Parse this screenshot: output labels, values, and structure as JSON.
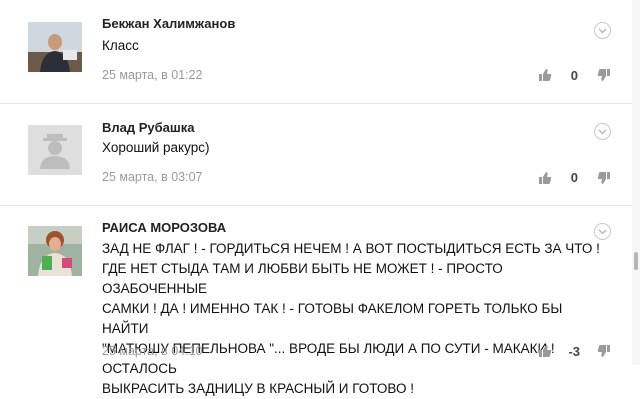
{
  "comments": [
    {
      "author": "Бекжан Халимжанов",
      "text": "Класс",
      "date": "25 марта, в 01:22",
      "score": "0",
      "avatar_icon": "user-photo"
    },
    {
      "author": "Влад Рубашка",
      "text": "Хороший ракурс)",
      "date": "25 марта, в 03:07",
      "score": "0",
      "avatar_icon": "default-avatar-icon"
    },
    {
      "author": "РАИСА МОРОЗОВА",
      "text": "ЗАД НЕ ФЛАГ ! - ГОРДИТЬСЯ НЕЧЕМ ! А ВОТ ПОСТЫДИТЬСЯ ЕСТЬ ЗА ЧТО !\nГДЕ НЕТ СТЫДА ТАМ И ЛЮБВИ БЫТЬ НЕ МОЖЕТ ! - ПРОСТО ОЗАБОЧЕННЫЕ\nСАМКИ ! ДА ! ИМЕННО ТАК ! - ГОТОВЫ ФАКЕЛОМ ГОРЕТЬ ТОЛЬКО БЫ НАЙТИ\n\"МАТЮШУ ПЕПЕЛЬНОВА \"... ВРОДЕ БЫ ЛЮДИ А ПО СУТИ - МАКАКИ ! ОСТАЛОСЬ\nВЫКРАСИТЬ ЗАДНИЦУ В КРАСНЫЙ И ГОТОВО !",
      "date": "25 марта, в 04:10",
      "score": "-3",
      "avatar_icon": "user-photo"
    }
  ],
  "icons": {
    "like": "thumbs-up-icon",
    "dislike": "thumbs-down-icon",
    "menu": "chevron-down-icon"
  },
  "colors": {
    "date": "#9a9a9a",
    "icon": "#9a9a9a",
    "divider": "#e6e6e6"
  }
}
